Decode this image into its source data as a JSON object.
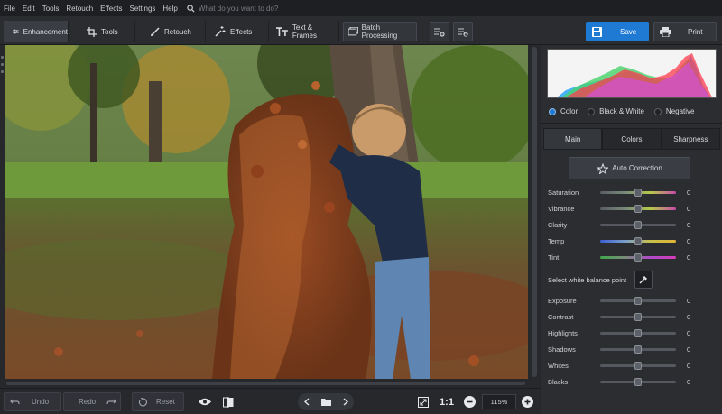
{
  "menu": {
    "items": [
      "File",
      "Edit",
      "Tools",
      "Retouch",
      "Effects",
      "Settings",
      "Help"
    ],
    "search_placeholder": "What do you want to do?"
  },
  "toolbar": {
    "tabs": [
      {
        "label": "Enhancement",
        "icon": "sliders-icon",
        "active": true
      },
      {
        "label": "Tools",
        "icon": "crop-icon",
        "active": false
      },
      {
        "label": "Retouch",
        "icon": "brush-icon",
        "active": false
      },
      {
        "label": "Effects",
        "icon": "magic-wand-icon",
        "active": false
      },
      {
        "label": "Text & Frames",
        "icon": "text-icon",
        "active": false
      }
    ],
    "batch_label": "Batch Processing",
    "save_label": "Save",
    "print_label": "Print"
  },
  "panel": {
    "color_modes": [
      {
        "label": "Color",
        "selected": true
      },
      {
        "label": "Black & White",
        "selected": false
      },
      {
        "label": "Negative",
        "selected": false
      }
    ],
    "subtabs": [
      {
        "label": "Main",
        "active": true
      },
      {
        "label": "Colors",
        "active": false
      },
      {
        "label": "Sharpness",
        "active": false
      }
    ],
    "auto_correction_label": "Auto Correction",
    "white_balance_label": "Select white balance point",
    "sliders_top": [
      {
        "label": "Saturation",
        "value": "0",
        "level": 0.5
      },
      {
        "label": "Vibrance",
        "value": "0",
        "level": 0.5
      },
      {
        "label": "Clarity",
        "value": "0",
        "level": 0.5
      },
      {
        "label": "Temp",
        "value": "0",
        "level": 0.5
      },
      {
        "label": "Tint",
        "value": "0",
        "level": 0.5
      }
    ],
    "sliders_bottom": [
      {
        "label": "Exposure",
        "value": "0",
        "level": 0.5
      },
      {
        "label": "Contrast",
        "value": "0",
        "level": 0.5
      },
      {
        "label": "Highlights",
        "value": "0",
        "level": 0.5
      },
      {
        "label": "Shadows",
        "value": "0",
        "level": 0.5
      },
      {
        "label": "Whites",
        "value": "0",
        "level": 0.5
      },
      {
        "label": "Blacks",
        "value": "0",
        "level": 0.5
      }
    ]
  },
  "bottom": {
    "undo_label": "Undo",
    "redo_label": "Redo",
    "reset_label": "Reset",
    "one_to_one_label": "1:1",
    "zoom_value": "115%"
  },
  "colors": {
    "accent": "#1f7ad4",
    "bg": "#2b2d31"
  }
}
